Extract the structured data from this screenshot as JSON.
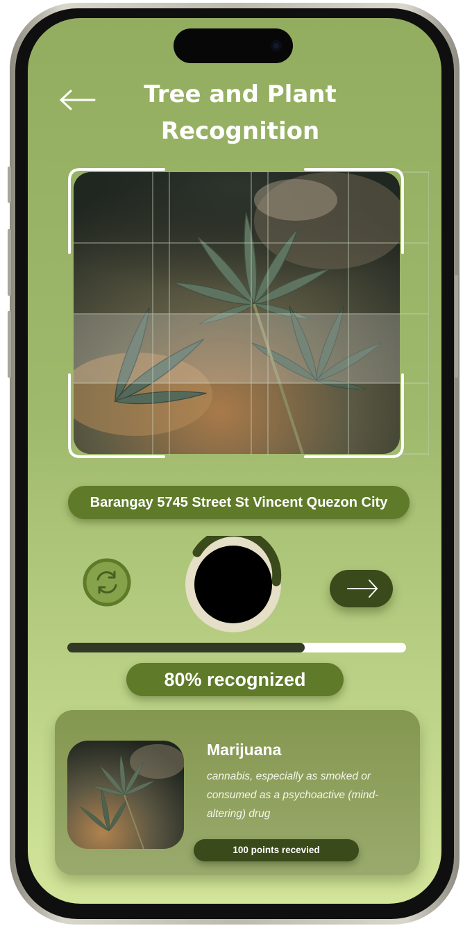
{
  "header": {
    "title_line1": "Tree and Plant",
    "title_line2": "Recognition",
    "back_icon": "arrow-left-icon"
  },
  "scan": {
    "image_subject": "cannabis-leaves-photo",
    "location": "Barangay 5745 Street St Vincent Quezon City"
  },
  "controls": {
    "switch_icon": "camera-switch-icon",
    "shutter_icon": "shutter-button",
    "next_icon": "arrow-right-icon"
  },
  "progress": {
    "value": 0.7,
    "label": "80% recognized"
  },
  "result": {
    "name": "Marijuana",
    "description": "cannabis, especially as smoked or consumed as a psychoactive (mind-altering) drug",
    "points": "100 points recevied"
  },
  "colors": {
    "accent_green": "#5f7a29",
    "dark_green": "#3a4a1a",
    "screen_top": "#93ad60",
    "screen_bottom": "#d3e59a"
  }
}
